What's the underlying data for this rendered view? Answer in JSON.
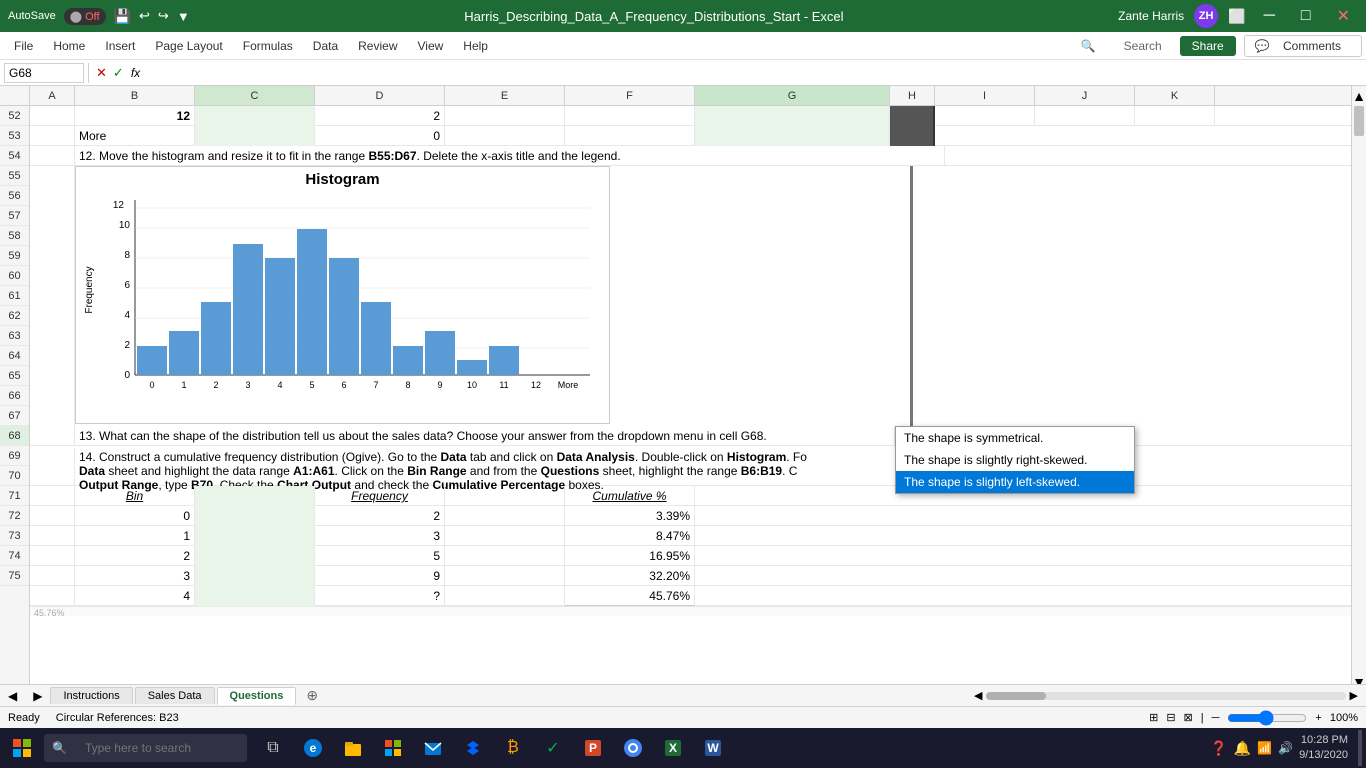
{
  "titlebar": {
    "autosave_label": "AutoSave",
    "autosave_state": "Off",
    "title": "Harris_Describing_Data_A_Frequency_Distributions_Start  -  Excel",
    "user_name": "Zante Harris",
    "user_initials": "ZH"
  },
  "menu": {
    "items": [
      "File",
      "Home",
      "Insert",
      "Page Layout",
      "Formulas",
      "Data",
      "Review",
      "View",
      "Help"
    ],
    "share_label": "Share",
    "comments_label": "Comments"
  },
  "formula_bar": {
    "cell_ref": "G68",
    "fx_symbol": "fx"
  },
  "columns": {
    "headers": [
      "A",
      "B",
      "C",
      "D",
      "E",
      "F",
      "G",
      "H",
      "I",
      "J",
      "K"
    ]
  },
  "rows": {
    "numbers": [
      52,
      53,
      54,
      55,
      56,
      57,
      58,
      59,
      60,
      61,
      62,
      63,
      64,
      65,
      66,
      67,
      68,
      69,
      70,
      71,
      72,
      73,
      74,
      75
    ]
  },
  "cells": {
    "B52": "12",
    "D52": "2",
    "B53": "More",
    "D53": "0",
    "instruction_12": "12. Move the histogram and resize it to fit in the range B55:D67. Delete the x-axis title and the legend.",
    "instruction_13": "13. What can the shape of the distribution tell us about the sales data? Choose your answer from the dropdown menu in cell G68.",
    "instruction_14_part1": "14. Construct a cumulative frequency distribution (Ogive). Go to the ",
    "instruction_14_data": "Data",
    "instruction_14_part2": " tab and click on ",
    "instruction_14_analysis": "Data Analysis",
    "instruction_14_part3": ". Double-click on ",
    "instruction_14_histogram": "Histogram",
    "instruction_14_part4": ". Fo",
    "instruction_14_line2_1": "Data",
    "instruction_14_line2_2": " sheet and highlight the data range ",
    "instruction_14_a1a61": "A1:A61",
    "instruction_14_line2_3": ". Click on the ",
    "instruction_14_binrange": "Bin Range",
    "instruction_14_line2_4": " and from the ",
    "instruction_14_questions": "Questions",
    "instruction_14_line2_5": " sheet, highlight the range ",
    "instruction_14_b6b19": "B6:B19",
    "instruction_14_line2_6": ". C",
    "instruction_14_line3_1": "Output Range",
    "instruction_14_line3_2": ", type ",
    "instruction_14_b70": "B70",
    "instruction_14_line3_3": ". Check the ",
    "instruction_14_chart": "Chart Output",
    "instruction_14_line3_4": " and check the ",
    "instruction_14_cumulative": "Cumulative Percentage",
    "instruction_14_line3_5": " boxes.",
    "table_headers": {
      "bin": "Bin",
      "frequency": "Frequency",
      "cumulative": "Cumulative %"
    },
    "table_rows": [
      {
        "bin": "0",
        "frequency": "2",
        "cumulative": "3.39%"
      },
      {
        "bin": "1",
        "frequency": "3",
        "cumulative": "8.47%"
      },
      {
        "bin": "2",
        "frequency": "5",
        "cumulative": "16.95%"
      },
      {
        "bin": "3",
        "frequency": "9",
        "cumulative": "32.20%"
      },
      {
        "bin": "4",
        "frequency": "?",
        "cumulative": "45.76%"
      }
    ]
  },
  "histogram": {
    "title": "Histogram",
    "x_labels": [
      "0",
      "1",
      "2",
      "3",
      "4",
      "5",
      "6",
      "7",
      "8",
      "9",
      "10",
      "11",
      "12",
      "More"
    ],
    "y_labels": [
      "0",
      "2",
      "4",
      "6",
      "8",
      "10",
      "12"
    ],
    "y_axis_title": "Frequency",
    "bars": [
      2,
      3,
      5,
      9,
      8,
      10,
      8,
      5,
      2,
      3,
      1,
      2,
      0,
      0
    ]
  },
  "dropdown": {
    "options": [
      {
        "text": "The shape is symmetrical.",
        "selected": false
      },
      {
        "text": "The shape is slightly right-skewed.",
        "selected": false
      },
      {
        "text": "The shape is slightly left-skewed.",
        "selected": true
      }
    ]
  },
  "sheet_tabs": {
    "tabs": [
      "Instructions",
      "Sales Data",
      "Questions"
    ],
    "active_tab": "Questions"
  },
  "status_bar": {
    "mode": "Ready",
    "circular_refs": "Circular References: B23",
    "view_icons": [
      "normal",
      "page-layout",
      "page-break"
    ],
    "zoom": "100%"
  },
  "taskbar": {
    "search_placeholder": "Type here to search",
    "time": "10:28 PM",
    "date": "9/13/2020"
  }
}
